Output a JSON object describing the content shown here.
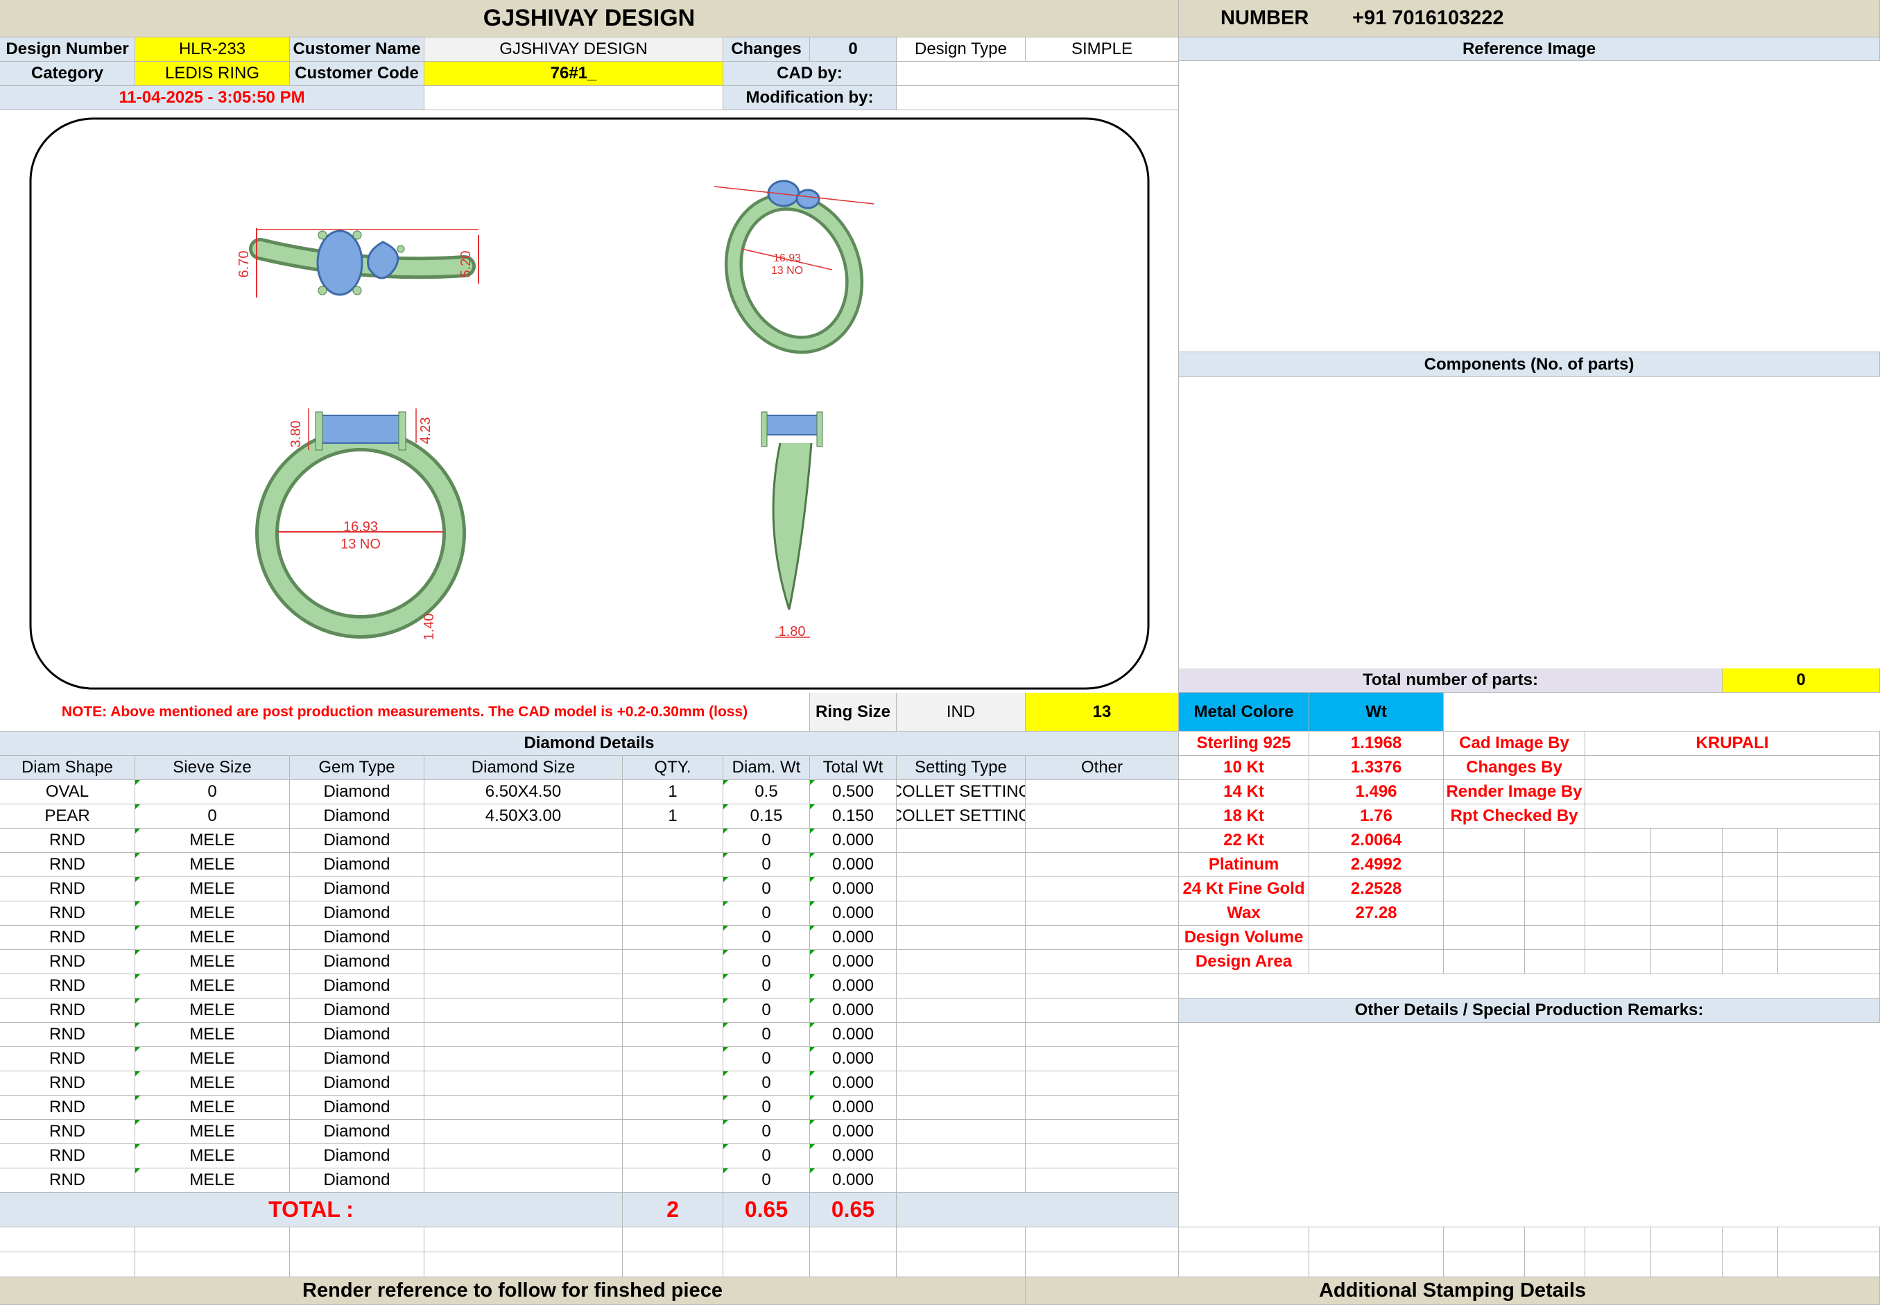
{
  "header": {
    "company": "GJSHIVAY DESIGN",
    "number_label": "NUMBER",
    "phone": "+91 7016103222"
  },
  "info": {
    "design_number_label": "Design Number",
    "design_number": "HLR-233",
    "customer_name_label": "Customer Name",
    "customer_name": "GJSHIVAY DESIGN",
    "changes_label": "Changes",
    "changes": "0",
    "design_type_label": "Design Type",
    "design_type": "SIMPLE",
    "category_label": "Category",
    "category": "LEDIS RING",
    "customer_code_label": "Customer Code",
    "customer_code": "76#1_",
    "cad_by_label": "CAD by:",
    "cad_by": "",
    "date": "11-04-2025 - 3:05:50 PM",
    "modification_by_label": "Modification by:",
    "modification_by": ""
  },
  "right_panel": {
    "reference_image": "Reference Image",
    "components": "Components (No. of parts)",
    "total_parts_label": "Total number of parts:",
    "total_parts": "0",
    "other_details": "Other Details / Special Production Remarks:"
  },
  "drawing": {
    "dims": {
      "top_h": "6.70",
      "top_h2": "5.20",
      "front_l": "3.80",
      "front_r": "4.23",
      "diameter": "16.93",
      "size": "13 NO",
      "bottom": "1.40",
      "side_w": "1.80",
      "iso_a": "3.80",
      "iso_b": "4.23",
      "iso_c": "16.93",
      "iso_d": "13 NO"
    }
  },
  "note": "NOTE: Above mentioned are post production measurements. The CAD model is +0.2-0.30mm (loss)",
  "ring_size": {
    "label": "Ring Size",
    "system": "IND",
    "value": "13"
  },
  "metal": {
    "label": "Metal Colore",
    "wt_label": "Wt",
    "rows": [
      {
        "name": "Sterling 925",
        "wt": "1.1968"
      },
      {
        "name": "10 Kt",
        "wt": "1.3376"
      },
      {
        "name": "14 Kt",
        "wt": "1.496"
      },
      {
        "name": "18 Kt",
        "wt": "1.76"
      },
      {
        "name": "22 Kt",
        "wt": "2.0064"
      },
      {
        "name": "Platinum",
        "wt": "2.4992"
      },
      {
        "name": "24 Kt Fine Gold",
        "wt": "2.2528"
      },
      {
        "name": "Wax",
        "wt": "27.28"
      },
      {
        "name": "Design Volume",
        "wt": ""
      },
      {
        "name": "Design Area",
        "wt": ""
      }
    ]
  },
  "credits": [
    {
      "label": "Cad Image By",
      "value": "KRUPALI"
    },
    {
      "label": "Changes By",
      "value": ""
    },
    {
      "label": "Render Image By",
      "value": ""
    },
    {
      "label": "Rpt Checked By",
      "value": ""
    }
  ],
  "diamond": {
    "title": "Diamond Details",
    "headers": [
      "Diam Shape",
      "Sieve Size",
      "Gem Type",
      "Diamond Size",
      "QTY.",
      "Diam. Wt",
      "Total Wt",
      "Setting Type",
      "Other"
    ],
    "rows": [
      [
        "OVAL",
        "0",
        "Diamond",
        "6.50X4.50",
        "1",
        "0.5",
        "0.500",
        "COLLET SETTING",
        ""
      ],
      [
        "PEAR",
        "0",
        "Diamond",
        "4.50X3.00",
        "1",
        "0.15",
        "0.150",
        "COLLET SETTING",
        ""
      ],
      [
        "RND",
        "MELE",
        "Diamond",
        "",
        "",
        "0",
        "0.000",
        "",
        ""
      ],
      [
        "RND",
        "MELE",
        "Diamond",
        "",
        "",
        "0",
        "0.000",
        "",
        ""
      ],
      [
        "RND",
        "MELE",
        "Diamond",
        "",
        "",
        "0",
        "0.000",
        "",
        ""
      ],
      [
        "RND",
        "MELE",
        "Diamond",
        "",
        "",
        "0",
        "0.000",
        "",
        ""
      ],
      [
        "RND",
        "MELE",
        "Diamond",
        "",
        "",
        "0",
        "0.000",
        "",
        ""
      ],
      [
        "RND",
        "MELE",
        "Diamond",
        "",
        "",
        "0",
        "0.000",
        "",
        ""
      ],
      [
        "RND",
        "MELE",
        "Diamond",
        "",
        "",
        "0",
        "0.000",
        "",
        ""
      ],
      [
        "RND",
        "MELE",
        "Diamond",
        "",
        "",
        "0",
        "0.000",
        "",
        ""
      ],
      [
        "RND",
        "MELE",
        "Diamond",
        "",
        "",
        "0",
        "0.000",
        "",
        ""
      ],
      [
        "RND",
        "MELE",
        "Diamond",
        "",
        "",
        "0",
        "0.000",
        "",
        ""
      ],
      [
        "RND",
        "MELE",
        "Diamond",
        "",
        "",
        "0",
        "0.000",
        "",
        ""
      ],
      [
        "RND",
        "MELE",
        "Diamond",
        "",
        "",
        "0",
        "0.000",
        "",
        ""
      ],
      [
        "RND",
        "MELE",
        "Diamond",
        "",
        "",
        "0",
        "0.000",
        "",
        ""
      ],
      [
        "RND",
        "MELE",
        "Diamond",
        "",
        "",
        "0",
        "0.000",
        "",
        ""
      ],
      [
        "RND",
        "MELE",
        "Diamond",
        "",
        "",
        "0",
        "0.000",
        "",
        ""
      ]
    ],
    "total_label": "TOTAL :",
    "total_qty": "2",
    "total_diam_wt": "0.65",
    "total_wt": "0.65"
  },
  "footer": {
    "render_ref": "Render reference to follow for finshed piece",
    "stamping": "Additional Stamping Details"
  },
  "colors": {
    "header": "#ddd9c4",
    "label_blue": "#dce6f1",
    "highlight": "#ffff00",
    "metal_header": "#00b0f0",
    "accent_red": "#ff0000",
    "ring_green": "#a8d5a2",
    "stone_blue": "#7da7e0"
  }
}
